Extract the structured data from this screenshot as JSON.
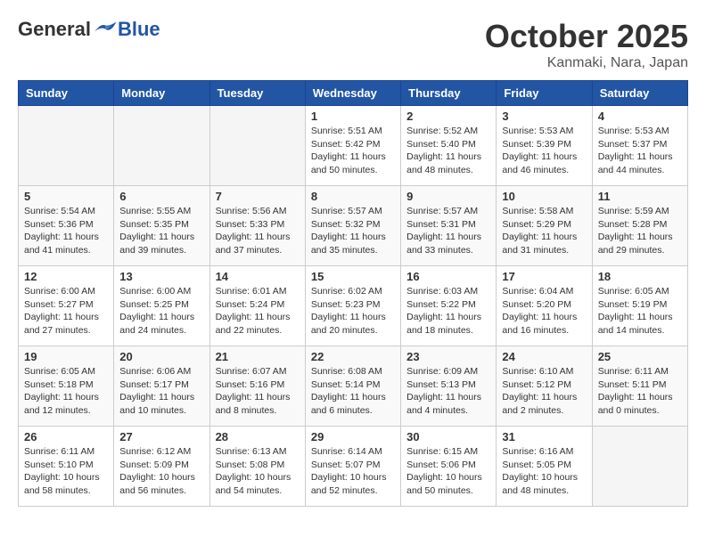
{
  "header": {
    "logo": {
      "general": "General",
      "blue": "Blue"
    },
    "title": "October 2025",
    "subtitle": "Kanmaki, Nara, Japan"
  },
  "weekdays": [
    "Sunday",
    "Monday",
    "Tuesday",
    "Wednesday",
    "Thursday",
    "Friday",
    "Saturday"
  ],
  "weeks": [
    [
      {
        "day": "",
        "info": ""
      },
      {
        "day": "",
        "info": ""
      },
      {
        "day": "",
        "info": ""
      },
      {
        "day": "1",
        "info": "Sunrise: 5:51 AM\nSunset: 5:42 PM\nDaylight: 11 hours\nand 50 minutes."
      },
      {
        "day": "2",
        "info": "Sunrise: 5:52 AM\nSunset: 5:40 PM\nDaylight: 11 hours\nand 48 minutes."
      },
      {
        "day": "3",
        "info": "Sunrise: 5:53 AM\nSunset: 5:39 PM\nDaylight: 11 hours\nand 46 minutes."
      },
      {
        "day": "4",
        "info": "Sunrise: 5:53 AM\nSunset: 5:37 PM\nDaylight: 11 hours\nand 44 minutes."
      }
    ],
    [
      {
        "day": "5",
        "info": "Sunrise: 5:54 AM\nSunset: 5:36 PM\nDaylight: 11 hours\nand 41 minutes."
      },
      {
        "day": "6",
        "info": "Sunrise: 5:55 AM\nSunset: 5:35 PM\nDaylight: 11 hours\nand 39 minutes."
      },
      {
        "day": "7",
        "info": "Sunrise: 5:56 AM\nSunset: 5:33 PM\nDaylight: 11 hours\nand 37 minutes."
      },
      {
        "day": "8",
        "info": "Sunrise: 5:57 AM\nSunset: 5:32 PM\nDaylight: 11 hours\nand 35 minutes."
      },
      {
        "day": "9",
        "info": "Sunrise: 5:57 AM\nSunset: 5:31 PM\nDaylight: 11 hours\nand 33 minutes."
      },
      {
        "day": "10",
        "info": "Sunrise: 5:58 AM\nSunset: 5:29 PM\nDaylight: 11 hours\nand 31 minutes."
      },
      {
        "day": "11",
        "info": "Sunrise: 5:59 AM\nSunset: 5:28 PM\nDaylight: 11 hours\nand 29 minutes."
      }
    ],
    [
      {
        "day": "12",
        "info": "Sunrise: 6:00 AM\nSunset: 5:27 PM\nDaylight: 11 hours\nand 27 minutes."
      },
      {
        "day": "13",
        "info": "Sunrise: 6:00 AM\nSunset: 5:25 PM\nDaylight: 11 hours\nand 24 minutes."
      },
      {
        "day": "14",
        "info": "Sunrise: 6:01 AM\nSunset: 5:24 PM\nDaylight: 11 hours\nand 22 minutes."
      },
      {
        "day": "15",
        "info": "Sunrise: 6:02 AM\nSunset: 5:23 PM\nDaylight: 11 hours\nand 20 minutes."
      },
      {
        "day": "16",
        "info": "Sunrise: 6:03 AM\nSunset: 5:22 PM\nDaylight: 11 hours\nand 18 minutes."
      },
      {
        "day": "17",
        "info": "Sunrise: 6:04 AM\nSunset: 5:20 PM\nDaylight: 11 hours\nand 16 minutes."
      },
      {
        "day": "18",
        "info": "Sunrise: 6:05 AM\nSunset: 5:19 PM\nDaylight: 11 hours\nand 14 minutes."
      }
    ],
    [
      {
        "day": "19",
        "info": "Sunrise: 6:05 AM\nSunset: 5:18 PM\nDaylight: 11 hours\nand 12 minutes."
      },
      {
        "day": "20",
        "info": "Sunrise: 6:06 AM\nSunset: 5:17 PM\nDaylight: 11 hours\nand 10 minutes."
      },
      {
        "day": "21",
        "info": "Sunrise: 6:07 AM\nSunset: 5:16 PM\nDaylight: 11 hours\nand 8 minutes."
      },
      {
        "day": "22",
        "info": "Sunrise: 6:08 AM\nSunset: 5:14 PM\nDaylight: 11 hours\nand 6 minutes."
      },
      {
        "day": "23",
        "info": "Sunrise: 6:09 AM\nSunset: 5:13 PM\nDaylight: 11 hours\nand 4 minutes."
      },
      {
        "day": "24",
        "info": "Sunrise: 6:10 AM\nSunset: 5:12 PM\nDaylight: 11 hours\nand 2 minutes."
      },
      {
        "day": "25",
        "info": "Sunrise: 6:11 AM\nSunset: 5:11 PM\nDaylight: 11 hours\nand 0 minutes."
      }
    ],
    [
      {
        "day": "26",
        "info": "Sunrise: 6:11 AM\nSunset: 5:10 PM\nDaylight: 10 hours\nand 58 minutes."
      },
      {
        "day": "27",
        "info": "Sunrise: 6:12 AM\nSunset: 5:09 PM\nDaylight: 10 hours\nand 56 minutes."
      },
      {
        "day": "28",
        "info": "Sunrise: 6:13 AM\nSunset: 5:08 PM\nDaylight: 10 hours\nand 54 minutes."
      },
      {
        "day": "29",
        "info": "Sunrise: 6:14 AM\nSunset: 5:07 PM\nDaylight: 10 hours\nand 52 minutes."
      },
      {
        "day": "30",
        "info": "Sunrise: 6:15 AM\nSunset: 5:06 PM\nDaylight: 10 hours\nand 50 minutes."
      },
      {
        "day": "31",
        "info": "Sunrise: 6:16 AM\nSunset: 5:05 PM\nDaylight: 10 hours\nand 48 minutes."
      },
      {
        "day": "",
        "info": ""
      }
    ]
  ]
}
